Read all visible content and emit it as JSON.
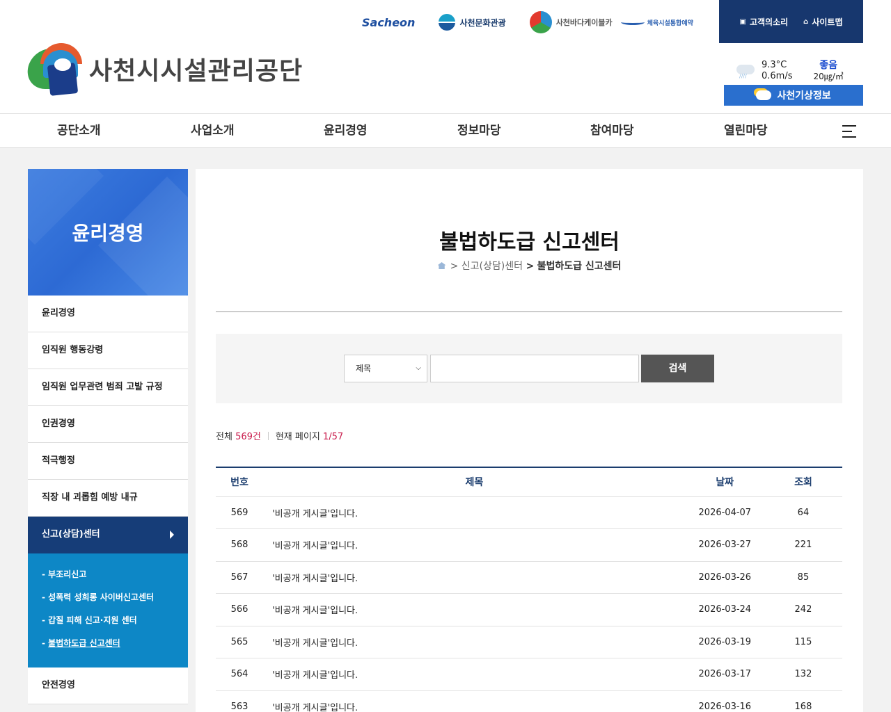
{
  "header": {
    "partners": [
      "Sacheon",
      "사천문화관광",
      "사천바다케이블카",
      "체육시설통합예약"
    ],
    "utility": {
      "voice": "고객의소리",
      "sitemap": "사이트맵"
    },
    "logo_text": "사천시시설관리공단",
    "weather": {
      "temp": "9.3°C",
      "wind": "0.6m/s",
      "air_quality": "좋음",
      "pm": "20㎍/㎥",
      "button": "사천기상정보"
    }
  },
  "gnb": [
    "공단소개",
    "사업소개",
    "윤리경영",
    "정보마당",
    "참여마당",
    "열린마당"
  ],
  "sidebar": {
    "title": "윤리경영",
    "items": [
      "윤리경영",
      "임직원 행동강령",
      "임직원 업무관련 범죄 고발 규정",
      "인권경영",
      "적극행정",
      "직장 내 괴롭힘 예방 내규",
      "신고(상담)센터",
      "안전경영"
    ],
    "sub_items": [
      "부조리신고",
      "성폭력 성희롱 사이버신고센터",
      "갑질 피해 신고·지원 센터",
      "불법하도급 신고센터"
    ]
  },
  "page": {
    "title": "불법하도급 신고센터",
    "breadcrumb": [
      ">",
      "신고(상담)센터",
      ">",
      "불법하도급 신고센터"
    ]
  },
  "search": {
    "select_value": "제목",
    "button": "검색"
  },
  "summary": {
    "total_label": "전체",
    "total": "569건",
    "page_label": "현재 페이지",
    "page": "1/57"
  },
  "board": {
    "headers": [
      "번호",
      "제목",
      "날짜",
      "조회"
    ],
    "rows": [
      [
        "569",
        "'비공개 게시글'입니다.",
        "2026-04-07",
        "64"
      ],
      [
        "568",
        "'비공개 게시글'입니다.",
        "2026-03-27",
        "221"
      ],
      [
        "567",
        "'비공개 게시글'입니다.",
        "2026-03-26",
        "85"
      ],
      [
        "566",
        "'비공개 게시글'입니다.",
        "2026-03-24",
        "242"
      ],
      [
        "565",
        "'비공개 게시글'입니다.",
        "2026-03-19",
        "115"
      ],
      [
        "564",
        "'비공개 게시글'입니다.",
        "2026-03-17",
        "132"
      ],
      [
        "563",
        "'비공개 게시글'입니다.",
        "2026-03-16",
        "168"
      ]
    ]
  }
}
